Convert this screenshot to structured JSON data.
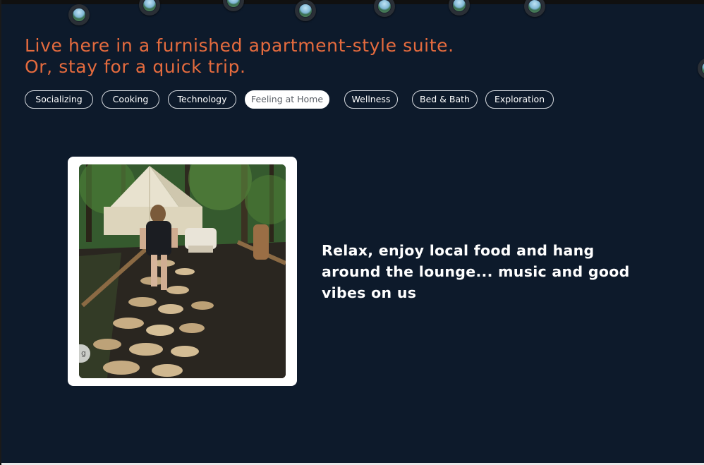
{
  "headline": {
    "line1": "Live here in a furnished apartment-style suite.",
    "line2": "Or, stay for a quick trip."
  },
  "tabs": [
    {
      "label": "Socializing",
      "active": false
    },
    {
      "label": "Cooking",
      "active": false
    },
    {
      "label": "Technology",
      "active": false
    },
    {
      "label": "Feeling at Home",
      "active": true
    },
    {
      "label": "Wellness",
      "active": false
    },
    {
      "label": "Bed & Bath",
      "active": false
    },
    {
      "label": "Exploration",
      "active": false
    }
  ],
  "feature": {
    "image_alt": "Woman walking on a wood-slice path toward a bell tent in the forest",
    "chip_text": "g",
    "caption": "Relax, enjoy local food and hang around the lounge... music and good vibes on us"
  },
  "colors": {
    "background": "#0d1a2b",
    "headline": "#e56b3e",
    "tab_border": "#d7dbe0",
    "active_tab_bg": "#ffffff"
  },
  "icons": {
    "bubble": "globe-icon"
  }
}
